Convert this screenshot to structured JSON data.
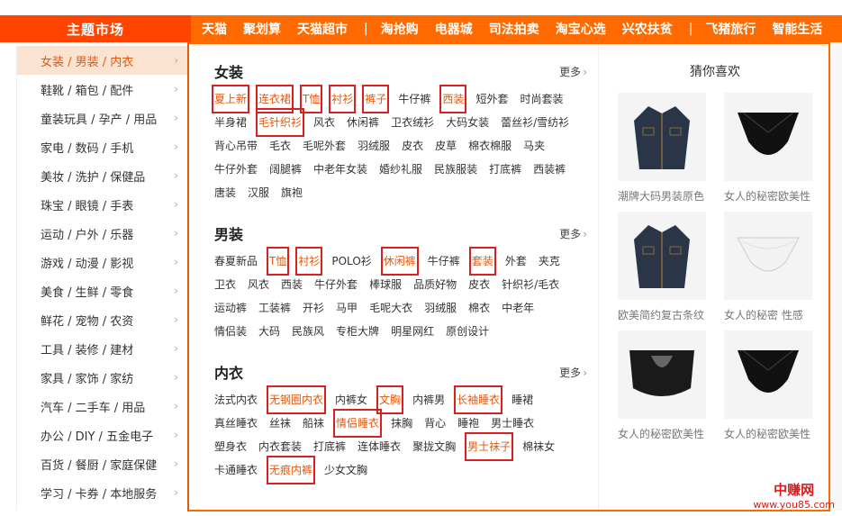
{
  "topnav": {
    "title": "主题市场",
    "links": [
      "天猫",
      "聚划算",
      "天猫超市",
      "|",
      "淘抢购",
      "电器城",
      "司法拍卖",
      "淘宝心选",
      "兴农扶贫",
      "|",
      "飞猪旅行",
      "智能生活"
    ]
  },
  "sidebar": {
    "items": [
      {
        "label": "女装 / 男装 / 内衣"
      },
      {
        "label": "鞋靴 / 箱包 / 配件"
      },
      {
        "label": "童装玩具 / 孕产 / 用品"
      },
      {
        "label": "家电 / 数码 / 手机"
      },
      {
        "label": "美妆 / 洗护 / 保健品"
      },
      {
        "label": "珠宝 / 眼镜 / 手表"
      },
      {
        "label": "运动 / 户外 / 乐器"
      },
      {
        "label": "游戏 / 动漫 / 影视"
      },
      {
        "label": "美食 / 生鲜 / 零食"
      },
      {
        "label": "鲜花 / 宠物 / 农资"
      },
      {
        "label": "工具 / 装修 / 建材"
      },
      {
        "label": "家具 / 家饰 / 家纺"
      },
      {
        "label": "汽车 / 二手车 / 用品"
      },
      {
        "label": "办公 / DIY / 五金电子"
      },
      {
        "label": "百货 / 餐厨 / 家庭保健"
      },
      {
        "label": "学习 / 卡券 / 本地服务"
      }
    ],
    "chevron": "›"
  },
  "sections": [
    {
      "title": "女装",
      "more": "更多",
      "tags": [
        {
          "t": "夏上新",
          "hl": true
        },
        {
          "t": "连衣裙",
          "hl": true
        },
        {
          "t": "T恤",
          "hl": true
        },
        {
          "t": "衬衫",
          "hl": true
        },
        {
          "t": "裤子",
          "hl": true
        },
        {
          "t": "牛仔裤",
          "hl": false
        },
        {
          "t": "西装",
          "hl": true
        },
        {
          "t": "短外套",
          "hl": false
        },
        {
          "t": "时尚套装",
          "hl": false
        },
        {
          "t": "半身裙",
          "hl": false
        },
        {
          "t": "毛针织衫",
          "hl": true
        },
        {
          "t": "风衣",
          "hl": false
        },
        {
          "t": "休闲裤",
          "hl": false
        },
        {
          "t": "卫衣绒衫",
          "hl": false
        },
        {
          "t": "大码女装",
          "hl": false
        },
        {
          "t": "蕾丝衫/雪纺衫",
          "hl": false
        },
        {
          "t": "背心吊带",
          "hl": false
        },
        {
          "t": "毛衣",
          "hl": false
        },
        {
          "t": "毛呢外套",
          "hl": false
        },
        {
          "t": "羽绒服",
          "hl": false
        },
        {
          "t": "皮衣",
          "hl": false
        },
        {
          "t": "皮草",
          "hl": false
        },
        {
          "t": "棉衣棉服",
          "hl": false
        },
        {
          "t": "马夹",
          "hl": false
        },
        {
          "t": "牛仔外套",
          "hl": false
        },
        {
          "t": "阔腿裤",
          "hl": false
        },
        {
          "t": "中老年女装",
          "hl": false
        },
        {
          "t": "婚纱礼服",
          "hl": false
        },
        {
          "t": "民族服装",
          "hl": false
        },
        {
          "t": "打底裤",
          "hl": false
        },
        {
          "t": "西装裤",
          "hl": false
        },
        {
          "t": "唐装",
          "hl": false
        },
        {
          "t": "汉服",
          "hl": false
        },
        {
          "t": "旗袍",
          "hl": false
        }
      ]
    },
    {
      "title": "男装",
      "more": "更多",
      "tags": [
        {
          "t": "春夏新品",
          "hl": false
        },
        {
          "t": "T恤",
          "hl": true
        },
        {
          "t": "衬衫",
          "hl": true
        },
        {
          "t": "POLO衫",
          "hl": false
        },
        {
          "t": "休闲裤",
          "hl": true
        },
        {
          "t": "牛仔裤",
          "hl": false
        },
        {
          "t": "套装",
          "hl": true
        },
        {
          "t": "外套",
          "hl": false
        },
        {
          "t": "夹克",
          "hl": false
        },
        {
          "t": "卫衣",
          "hl": false
        },
        {
          "t": "风衣",
          "hl": false
        },
        {
          "t": "西装",
          "hl": false
        },
        {
          "t": "牛仔外套",
          "hl": false
        },
        {
          "t": "棒球服",
          "hl": false
        },
        {
          "t": "品质好物",
          "hl": false
        },
        {
          "t": "皮衣",
          "hl": false
        },
        {
          "t": "针织衫/毛衣",
          "hl": false
        },
        {
          "t": "运动裤",
          "hl": false
        },
        {
          "t": "工装裤",
          "hl": false
        },
        {
          "t": "开衫",
          "hl": false
        },
        {
          "t": "马甲",
          "hl": false
        },
        {
          "t": "毛呢大衣",
          "hl": false
        },
        {
          "t": "羽绒服",
          "hl": false
        },
        {
          "t": "棉衣",
          "hl": false
        },
        {
          "t": "中老年",
          "hl": false
        },
        {
          "t": "情侣装",
          "hl": false
        },
        {
          "t": "大码",
          "hl": false
        },
        {
          "t": "民族风",
          "hl": false
        },
        {
          "t": "专柜大牌",
          "hl": false
        },
        {
          "t": "明星网红",
          "hl": false
        },
        {
          "t": "原创设计",
          "hl": false
        }
      ]
    },
    {
      "title": "内衣",
      "more": "更多",
      "tags": [
        {
          "t": "法式内衣",
          "hl": false
        },
        {
          "t": "无钢圈内衣",
          "hl": true
        },
        {
          "t": "内裤女",
          "hl": false
        },
        {
          "t": "文胸",
          "hl": true
        },
        {
          "t": "内裤男",
          "hl": false
        },
        {
          "t": "长袖睡衣",
          "hl": true
        },
        {
          "t": "睡裙",
          "hl": false
        },
        {
          "t": "真丝睡衣",
          "hl": false
        },
        {
          "t": "丝袜",
          "hl": false
        },
        {
          "t": "船袜",
          "hl": false
        },
        {
          "t": "情侣睡衣",
          "hl": true
        },
        {
          "t": "抹胸",
          "hl": false
        },
        {
          "t": "背心",
          "hl": false
        },
        {
          "t": "睡袍",
          "hl": false
        },
        {
          "t": "男士睡衣",
          "hl": false
        },
        {
          "t": "塑身衣",
          "hl": false
        },
        {
          "t": "内衣套装",
          "hl": false
        },
        {
          "t": "打底裤",
          "hl": false
        },
        {
          "t": "连体睡衣",
          "hl": false
        },
        {
          "t": "聚拢文胸",
          "hl": false
        },
        {
          "t": "男士袜子",
          "hl": true
        },
        {
          "t": "棉袜女",
          "hl": false
        },
        {
          "t": "卡通睡衣",
          "hl": false
        },
        {
          "t": "无痕内裤",
          "hl": true
        },
        {
          "t": "少女文胸",
          "hl": false
        }
      ]
    }
  ],
  "guess": {
    "title": "猜你喜欢",
    "products": [
      {
        "caption": "潮牌大码男装原色",
        "icon": "denim-jacket-icon"
      },
      {
        "caption": "女人的秘密欧美性",
        "icon": "black-lingerie-icon"
      },
      {
        "caption": "欧美简约复古条纹",
        "icon": "denim-jacket-icon"
      },
      {
        "caption": "女人的秘密 性感",
        "icon": "white-lingerie-icon"
      },
      {
        "caption": "女人的秘密欧美性",
        "icon": "lace-lingerie-icon"
      },
      {
        "caption": "女人的秘密欧美性",
        "icon": "black-lingerie-icon"
      }
    ]
  },
  "watermark": {
    "line1": "中赚网",
    "line2": "www.you85.com"
  },
  "colors": {
    "accent": "#ff6a00",
    "highlight_box": "#d82020",
    "active_bg": "#fbe3d2",
    "highlight_text": "#e4590f"
  }
}
